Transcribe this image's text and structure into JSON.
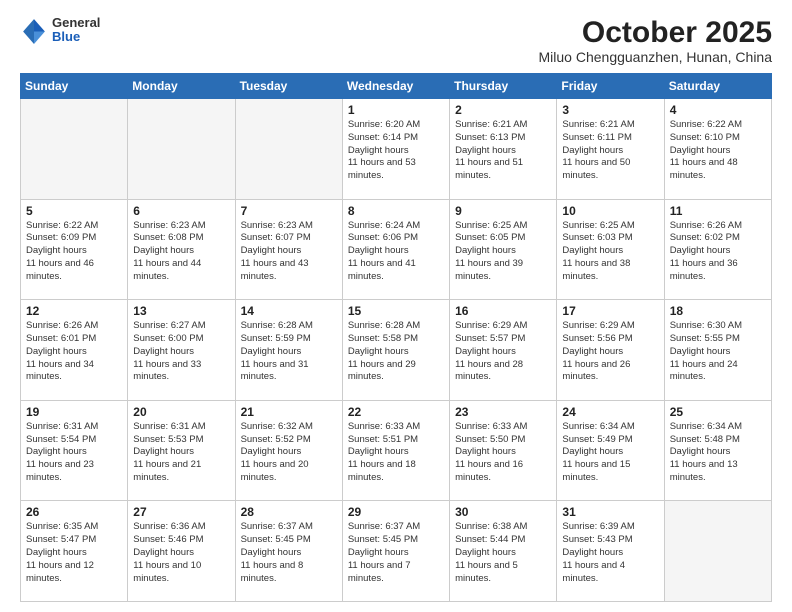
{
  "logo": {
    "general": "General",
    "blue": "Blue"
  },
  "header": {
    "month_year": "October 2025",
    "location": "Miluo Chengguanzhen, Hunan, China"
  },
  "days_of_week": [
    "Sunday",
    "Monday",
    "Tuesday",
    "Wednesday",
    "Thursday",
    "Friday",
    "Saturday"
  ],
  "weeks": [
    [
      {
        "day": "",
        "empty": true
      },
      {
        "day": "",
        "empty": true
      },
      {
        "day": "",
        "empty": true
      },
      {
        "day": "1",
        "sunrise": "6:20 AM",
        "sunset": "6:14 PM",
        "daylight": "11 hours and 53 minutes."
      },
      {
        "day": "2",
        "sunrise": "6:21 AM",
        "sunset": "6:13 PM",
        "daylight": "11 hours and 51 minutes."
      },
      {
        "day": "3",
        "sunrise": "6:21 AM",
        "sunset": "6:11 PM",
        "daylight": "11 hours and 50 minutes."
      },
      {
        "day": "4",
        "sunrise": "6:22 AM",
        "sunset": "6:10 PM",
        "daylight": "11 hours and 48 minutes."
      }
    ],
    [
      {
        "day": "5",
        "sunrise": "6:22 AM",
        "sunset": "6:09 PM",
        "daylight": "11 hours and 46 minutes."
      },
      {
        "day": "6",
        "sunrise": "6:23 AM",
        "sunset": "6:08 PM",
        "daylight": "11 hours and 44 minutes."
      },
      {
        "day": "7",
        "sunrise": "6:23 AM",
        "sunset": "6:07 PM",
        "daylight": "11 hours and 43 minutes."
      },
      {
        "day": "8",
        "sunrise": "6:24 AM",
        "sunset": "6:06 PM",
        "daylight": "11 hours and 41 minutes."
      },
      {
        "day": "9",
        "sunrise": "6:25 AM",
        "sunset": "6:05 PM",
        "daylight": "11 hours and 39 minutes."
      },
      {
        "day": "10",
        "sunrise": "6:25 AM",
        "sunset": "6:03 PM",
        "daylight": "11 hours and 38 minutes."
      },
      {
        "day": "11",
        "sunrise": "6:26 AM",
        "sunset": "6:02 PM",
        "daylight": "11 hours and 36 minutes."
      }
    ],
    [
      {
        "day": "12",
        "sunrise": "6:26 AM",
        "sunset": "6:01 PM",
        "daylight": "11 hours and 34 minutes."
      },
      {
        "day": "13",
        "sunrise": "6:27 AM",
        "sunset": "6:00 PM",
        "daylight": "11 hours and 33 minutes."
      },
      {
        "day": "14",
        "sunrise": "6:28 AM",
        "sunset": "5:59 PM",
        "daylight": "11 hours and 31 minutes."
      },
      {
        "day": "15",
        "sunrise": "6:28 AM",
        "sunset": "5:58 PM",
        "daylight": "11 hours and 29 minutes."
      },
      {
        "day": "16",
        "sunrise": "6:29 AM",
        "sunset": "5:57 PM",
        "daylight": "11 hours and 28 minutes."
      },
      {
        "day": "17",
        "sunrise": "6:29 AM",
        "sunset": "5:56 PM",
        "daylight": "11 hours and 26 minutes."
      },
      {
        "day": "18",
        "sunrise": "6:30 AM",
        "sunset": "5:55 PM",
        "daylight": "11 hours and 24 minutes."
      }
    ],
    [
      {
        "day": "19",
        "sunrise": "6:31 AM",
        "sunset": "5:54 PM",
        "daylight": "11 hours and 23 minutes."
      },
      {
        "day": "20",
        "sunrise": "6:31 AM",
        "sunset": "5:53 PM",
        "daylight": "11 hours and 21 minutes."
      },
      {
        "day": "21",
        "sunrise": "6:32 AM",
        "sunset": "5:52 PM",
        "daylight": "11 hours and 20 minutes."
      },
      {
        "day": "22",
        "sunrise": "6:33 AM",
        "sunset": "5:51 PM",
        "daylight": "11 hours and 18 minutes."
      },
      {
        "day": "23",
        "sunrise": "6:33 AM",
        "sunset": "5:50 PM",
        "daylight": "11 hours and 16 minutes."
      },
      {
        "day": "24",
        "sunrise": "6:34 AM",
        "sunset": "5:49 PM",
        "daylight": "11 hours and 15 minutes."
      },
      {
        "day": "25",
        "sunrise": "6:34 AM",
        "sunset": "5:48 PM",
        "daylight": "11 hours and 13 minutes."
      }
    ],
    [
      {
        "day": "26",
        "sunrise": "6:35 AM",
        "sunset": "5:47 PM",
        "daylight": "11 hours and 12 minutes."
      },
      {
        "day": "27",
        "sunrise": "6:36 AM",
        "sunset": "5:46 PM",
        "daylight": "11 hours and 10 minutes."
      },
      {
        "day": "28",
        "sunrise": "6:37 AM",
        "sunset": "5:45 PM",
        "daylight": "11 hours and 8 minutes."
      },
      {
        "day": "29",
        "sunrise": "6:37 AM",
        "sunset": "5:45 PM",
        "daylight": "11 hours and 7 minutes."
      },
      {
        "day": "30",
        "sunrise": "6:38 AM",
        "sunset": "5:44 PM",
        "daylight": "11 hours and 5 minutes."
      },
      {
        "day": "31",
        "sunrise": "6:39 AM",
        "sunset": "5:43 PM",
        "daylight": "11 hours and 4 minutes."
      },
      {
        "day": "",
        "empty": true
      }
    ]
  ],
  "labels": {
    "sunrise": "Sunrise:",
    "sunset": "Sunset:",
    "daylight": "Daylight hours"
  }
}
